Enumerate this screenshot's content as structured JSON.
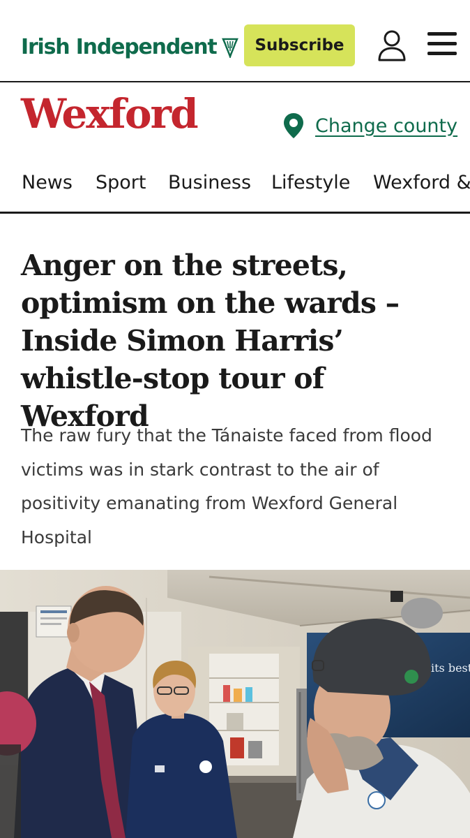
{
  "header": {
    "logo_text": "Irish Independent",
    "logo_icon": "harp-icon",
    "subscribe_label": "Subscribe",
    "user_icon": "user-icon",
    "menu_icon": "hamburger-menu-icon"
  },
  "county": {
    "title": "Wexford",
    "change_label": "Change county",
    "pin_icon": "location-pin-icon"
  },
  "nav": {
    "items": [
      "News",
      "Sport",
      "Business",
      "Lifestyle",
      "Wexford &"
    ]
  },
  "article": {
    "headline": "Anger on the streets, optimism on the wards – Inside Simon Harris’ whistle-stop tour of Wexford",
    "standfirst": "The raw fury that the Tánaiste faced from flood victims was in stark contrast to the air of positivity emanating from Wexford General Hospital",
    "photo_sign_text": "its best"
  },
  "colors": {
    "brand_green": "#0f6b4c",
    "county_red": "#c4262e",
    "subscribe_yellow": "#d6e35a"
  }
}
